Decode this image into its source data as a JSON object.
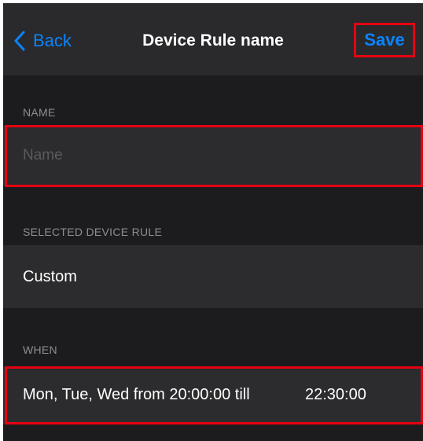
{
  "nav": {
    "back_label": "Back",
    "title": "Device Rule name",
    "save_label": "Save"
  },
  "sections": {
    "name": {
      "header": "NAME",
      "placeholder": "Name",
      "value": ""
    },
    "device_rule": {
      "header": "SELECTED DEVICE RULE",
      "selected_value": "Custom"
    },
    "when": {
      "header": "WHEN",
      "schedule_text": "Mon, Tue, Wed from 20:00:00 till",
      "end_time": "22:30:00"
    }
  },
  "colors": {
    "accent": "#0a84ff",
    "highlight_outline": "#e60012",
    "background": "#1c1c1e",
    "row_background": "#2c2c2e",
    "secondary_text": "#8e8e93"
  },
  "icons": {
    "back": "chevron-left-icon"
  }
}
